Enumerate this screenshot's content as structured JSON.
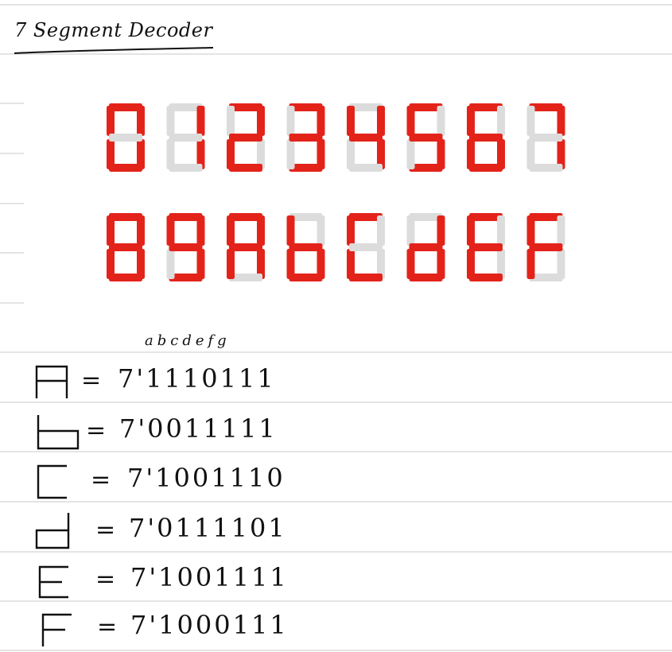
{
  "title": "7 Segment Decoder",
  "colors": {
    "segment_on": "#e3231a",
    "segment_off": "#dcdcdc",
    "rule_line": "#c9c9c9",
    "ink": "#111111"
  },
  "display": {
    "rows": [
      {
        "digits": [
          {
            "char": "0",
            "segments": "1111110"
          },
          {
            "char": "1",
            "segments": "0110000"
          },
          {
            "char": "2",
            "segments": "1101101"
          },
          {
            "char": "3",
            "segments": "1111001"
          },
          {
            "char": "4",
            "segments": "0110011"
          },
          {
            "char": "5",
            "segments": "1011011"
          },
          {
            "char": "6",
            "segments": "1011111"
          },
          {
            "char": "7",
            "segments": "1110000"
          }
        ]
      },
      {
        "digits": [
          {
            "char": "8",
            "segments": "1111111"
          },
          {
            "char": "9",
            "segments": "1111011"
          },
          {
            "char": "A",
            "segments": "1110111"
          },
          {
            "char": "b",
            "segments": "0011111"
          },
          {
            "char": "C",
            "segments": "1001110"
          },
          {
            "char": "d",
            "segments": "0111101"
          },
          {
            "char": "E",
            "segments": "1001111"
          },
          {
            "char": "F",
            "segments": "1000111"
          }
        ]
      }
    ]
  },
  "legend": "abcdefg",
  "equations": [
    {
      "symbol": "A",
      "equals": "=",
      "code": "7'1110111"
    },
    {
      "symbol": "b",
      "equals": "=",
      "code": "7'0011111"
    },
    {
      "symbol": "C",
      "equals": "=",
      "code": "7'1001110"
    },
    {
      "symbol": "d",
      "equals": "=",
      "code": "7'0111101"
    },
    {
      "symbol": "E",
      "equals": "=",
      "code": "7'1001111"
    },
    {
      "symbol": "F",
      "equals": "=",
      "code": "7'1000111"
    }
  ]
}
